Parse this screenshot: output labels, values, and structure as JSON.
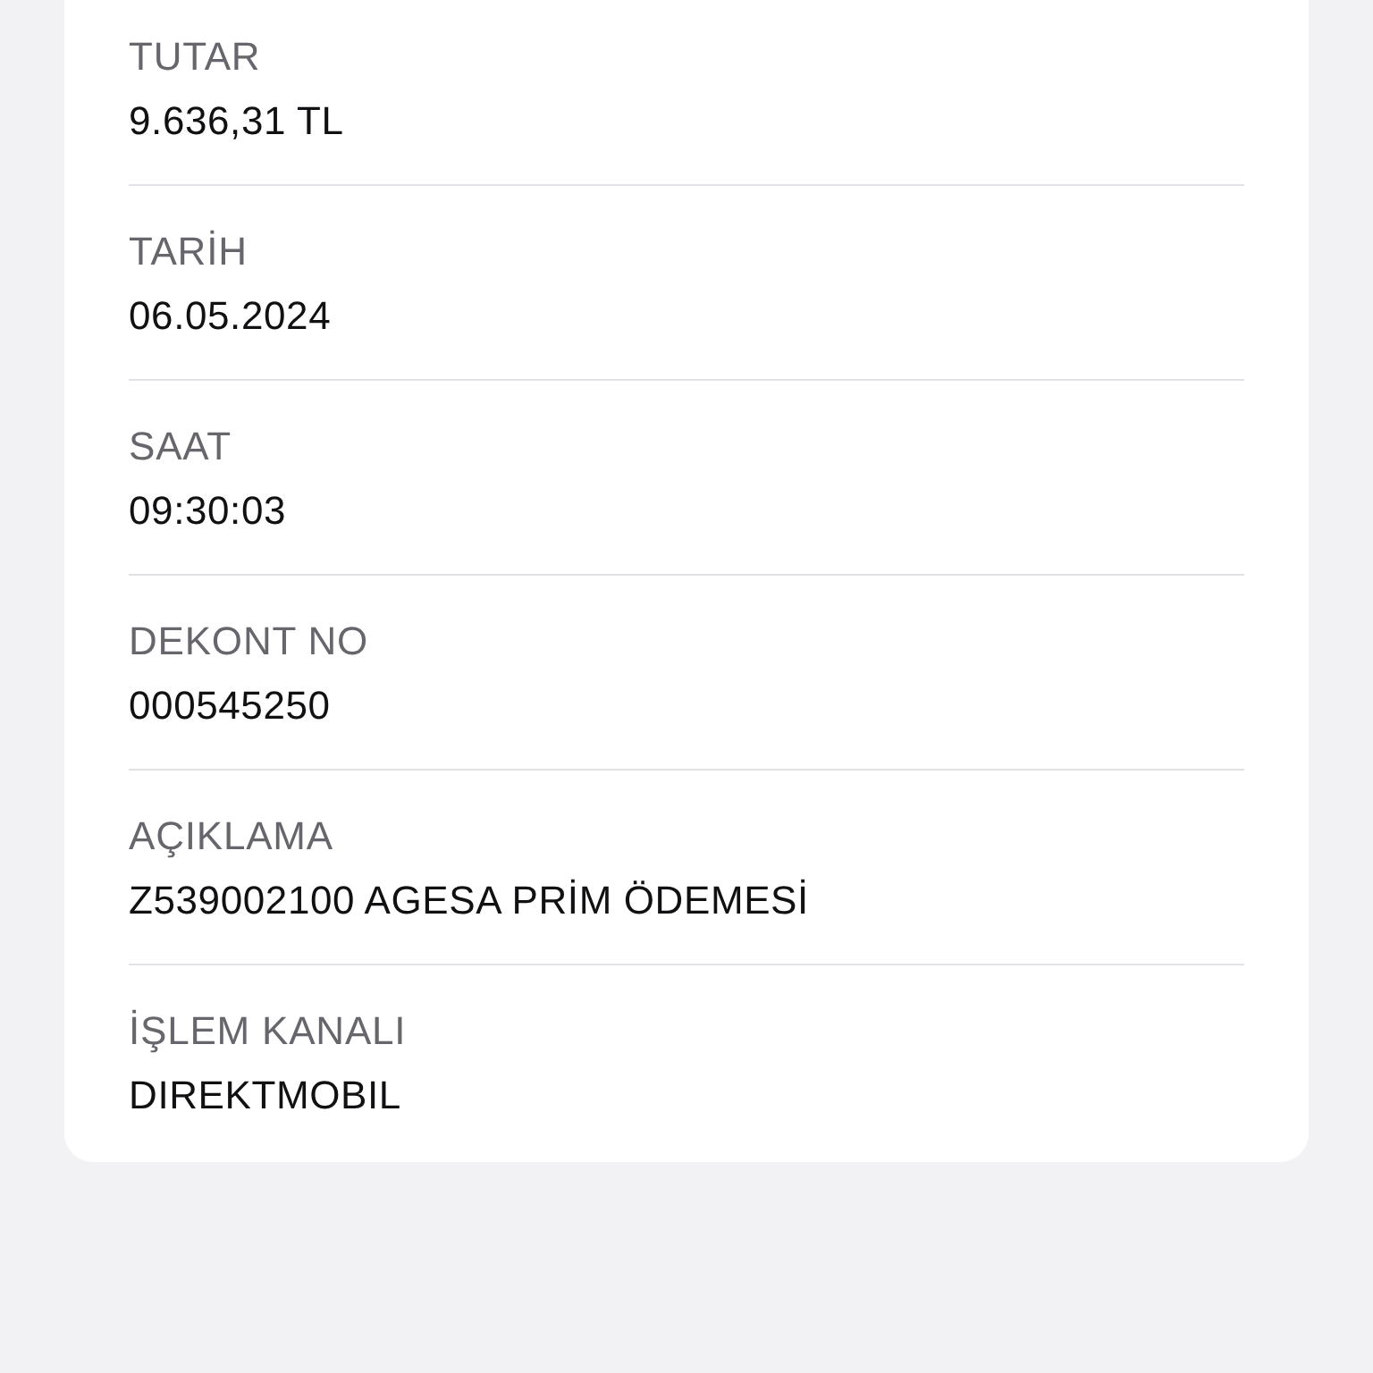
{
  "details": [
    {
      "label": "TUTAR",
      "value": "9.636,31 TL"
    },
    {
      "label": "TARİH",
      "value": "06.05.2024"
    },
    {
      "label": "SAAT",
      "value": "09:30:03"
    },
    {
      "label": "DEKONT NO",
      "value": "000545250"
    },
    {
      "label": "AÇIKLAMA",
      "value": "Z539002100 AGESA PRİM ÖDEMESİ"
    },
    {
      "label": "İŞLEM KANALI",
      "value": "DIREKTMOBIL"
    }
  ]
}
